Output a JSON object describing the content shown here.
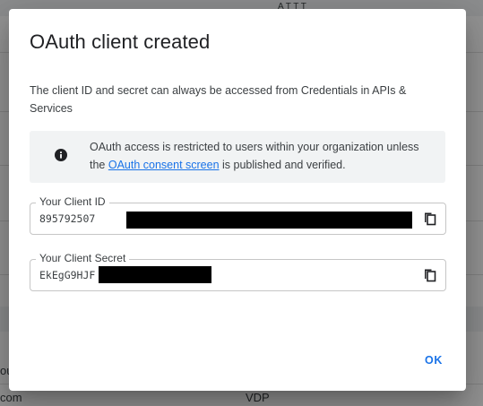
{
  "background": {
    "top_right_text": "A T T T",
    "left_bottom_1": "ou",
    "left_bottom_2": "com",
    "right_bottom": "VDP"
  },
  "dialog": {
    "title": "OAuth client created",
    "description": "The client ID and secret can always be accessed from Credentials in APIs & Services",
    "notice": {
      "icon": "info-icon",
      "text_before": "OAuth access is restricted to users within your organization unless the ",
      "link_text": "OAuth consent screen",
      "text_after": " is published and verified."
    },
    "client_id": {
      "label": "Your Client ID",
      "value": "895792507",
      "copy_icon": "copy-icon"
    },
    "client_secret": {
      "label": "Your Client Secret",
      "value": "EkEgG9HJF",
      "copy_icon": "copy-icon"
    },
    "ok_label": "OK"
  },
  "colors": {
    "accent": "#1a73e8",
    "notice_bg": "#f1f3f4",
    "text": "#3c4043",
    "title": "#202124"
  }
}
